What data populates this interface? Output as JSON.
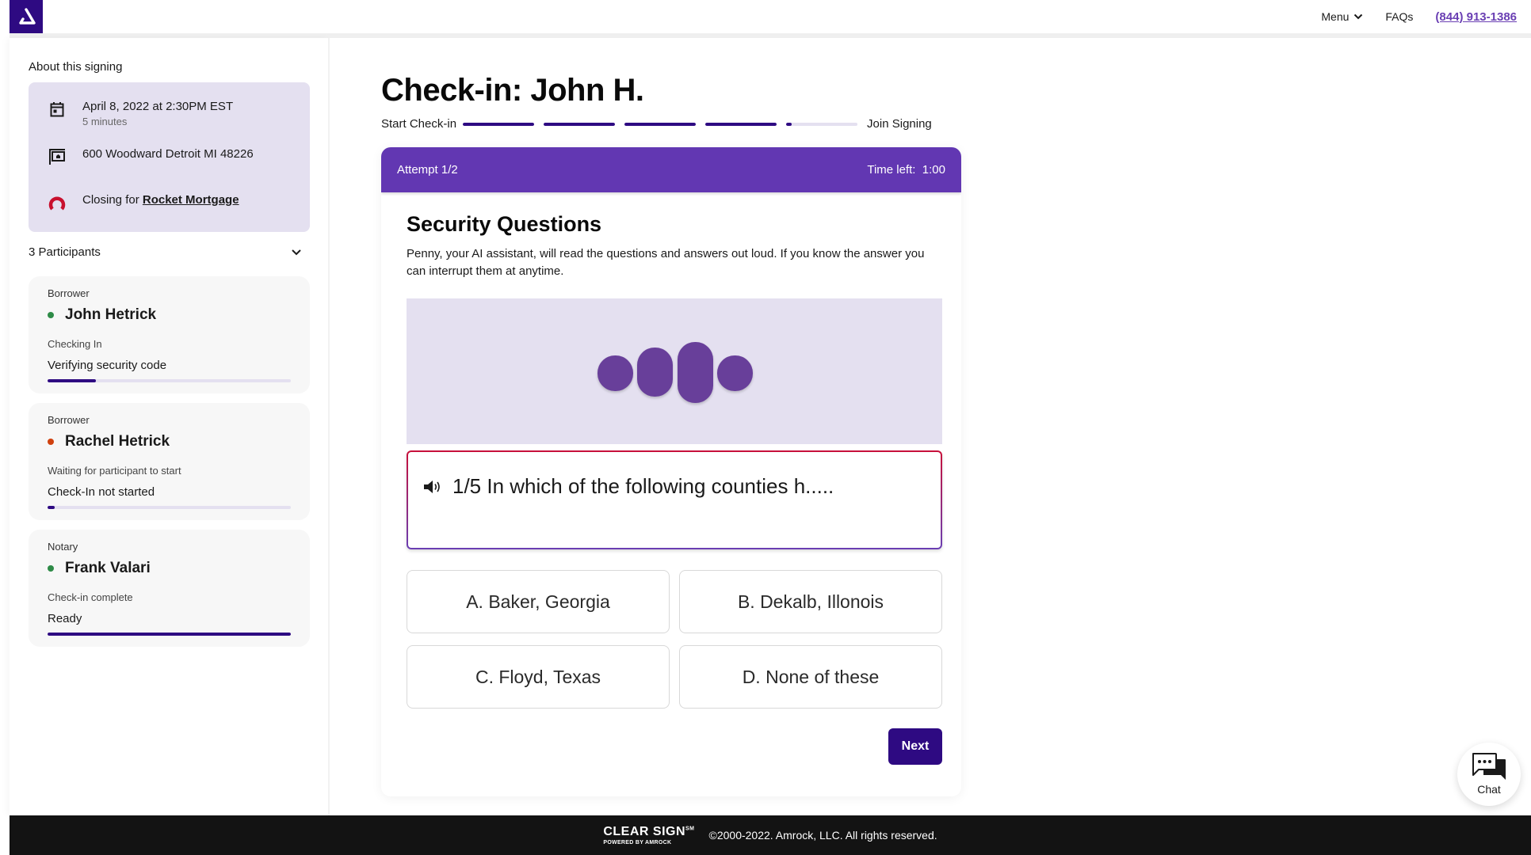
{
  "header": {
    "logo_alt": "Amrock logo",
    "nav": {
      "menu_label": "Menu",
      "faqs_label": "FAQs",
      "phone": "(844) 913-1386"
    }
  },
  "sidebar": {
    "about_title": "About this signing",
    "about": {
      "datetime": "April 8, 2022 at 2:30PM EST",
      "duration": "5 minutes",
      "address": "600 Woodward Detroit MI 48226",
      "closing_prefix": "Closing for",
      "closing_company": "Rocket Mortgage"
    },
    "participants_title": "3 Participants",
    "participants": [
      {
        "role": "Borrower",
        "name": "John Hetrick",
        "status_color": "#2e8b47",
        "status": "Checking In",
        "step": "Verifying security code",
        "progress": 0.2
      },
      {
        "role": "Borrower",
        "name": "Rachel Hetrick",
        "status_color": "#d0410f",
        "status": "Waiting for participant to start",
        "step": "Check-In not started",
        "progress": 0.03
      },
      {
        "role": "Notary",
        "name": "Frank Valari",
        "status_color": "#2e8b47",
        "status": "Check-in complete",
        "step": "Ready",
        "progress": 1.0
      }
    ]
  },
  "main": {
    "title": "Check-in: John H.",
    "progress": {
      "start_label": "Start Check-in",
      "end_label": "Join Signing",
      "segments": [
        1.0,
        1.0,
        1.0,
        1.0,
        0.08
      ]
    },
    "card": {
      "attempt": "Attempt 1/2",
      "time_left": "Time left:  1:00",
      "title": "Security Questions",
      "description": "Penny, your AI assistant, will read the questions and answers out loud. If you know the answer you can interrupt them at anytime.",
      "question": "1/5 In which of the following counties h.....",
      "answers": [
        "A. Baker, Georgia",
        "B. Dekalb, Illonois",
        "C. Floyd, Texas",
        "D. None of these"
      ],
      "next_label": "Next"
    }
  },
  "chat": {
    "label": "Chat"
  },
  "footer": {
    "brand": "CLEAR SIGN",
    "brand_mark": "SM",
    "brand_sub": "POWERED BY AMROCK",
    "copyright": "©2000-2022. Amrock, LLC. All rights reserved."
  },
  "colors": {
    "brand_dark": "#2e0a82",
    "brand_header": "#6237b2",
    "lavender": "#e4e0f0",
    "rocket_red": "#c8102e",
    "phone_link": "#6a3fb3"
  }
}
